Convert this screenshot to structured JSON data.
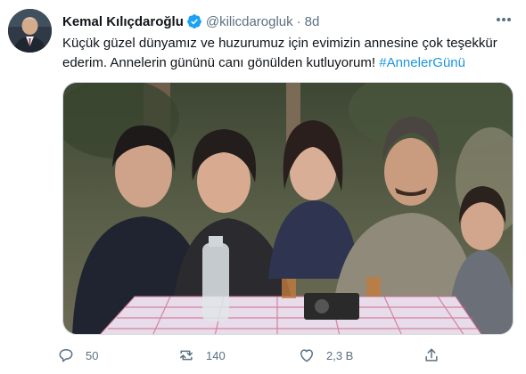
{
  "tweet": {
    "author_name": "Kemal Kılıçdaroğlu",
    "handle": "@kilicdarogluk",
    "separator": "·",
    "time": "8d",
    "text": "Küçük güzel dünyamız ve huzurumuz için evimizin annesine çok teşekkür ederim. Annelerin gününü canı gönülden kutluyorum! ",
    "hashtag": "#AnnelerGünü"
  },
  "actions": {
    "reply_count": "50",
    "retweet_count": "140",
    "like_count": "2,3 B"
  },
  "icons": {
    "verified": "verified-badge-icon",
    "more": "more-icon",
    "reply": "reply-icon",
    "retweet": "retweet-icon",
    "like": "like-icon",
    "share": "share-icon"
  },
  "colors": {
    "accent": "#1b95e0",
    "muted": "#5b7083",
    "verified": "#1da1f2"
  }
}
